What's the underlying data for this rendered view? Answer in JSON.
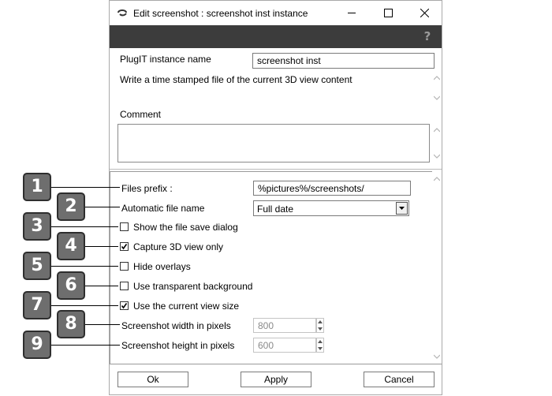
{
  "window": {
    "title": "Edit screenshot : screenshot inst instance",
    "controls": {
      "minimize": "minimize",
      "maximize": "maximize",
      "close": "close"
    }
  },
  "header": {
    "help_icon": "help-icon"
  },
  "instance": {
    "name_label": "PlugIT instance name",
    "name_value": "screenshot inst",
    "description": "Write a time stamped file of the current 3D view content"
  },
  "comment": {
    "label": "Comment",
    "value": ""
  },
  "params": {
    "files_prefix_label": "Files prefix :",
    "files_prefix_value": "%pictures%/screenshots/",
    "auto_file_name_label": "Automatic file name",
    "auto_file_name_value": "Full date",
    "show_save_dialog_label": "Show the file save dialog",
    "show_save_dialog_checked": false,
    "capture_3d_label": "Capture 3D view only",
    "capture_3d_checked": true,
    "hide_overlays_label": "Hide overlays",
    "hide_overlays_checked": false,
    "transparent_bg_label": "Use transparent background",
    "transparent_bg_checked": false,
    "current_view_size_label": "Use the current view size",
    "current_view_size_checked": true,
    "width_label": "Screenshot width in pixels",
    "width_value": "800",
    "height_label": "Screenshot height in pixels",
    "height_value": "600"
  },
  "buttons": {
    "ok": "Ok",
    "apply": "Apply",
    "cancel": "Cancel"
  },
  "badges": [
    "1",
    "2",
    "3",
    "4",
    "5",
    "6",
    "7",
    "8",
    "9"
  ]
}
